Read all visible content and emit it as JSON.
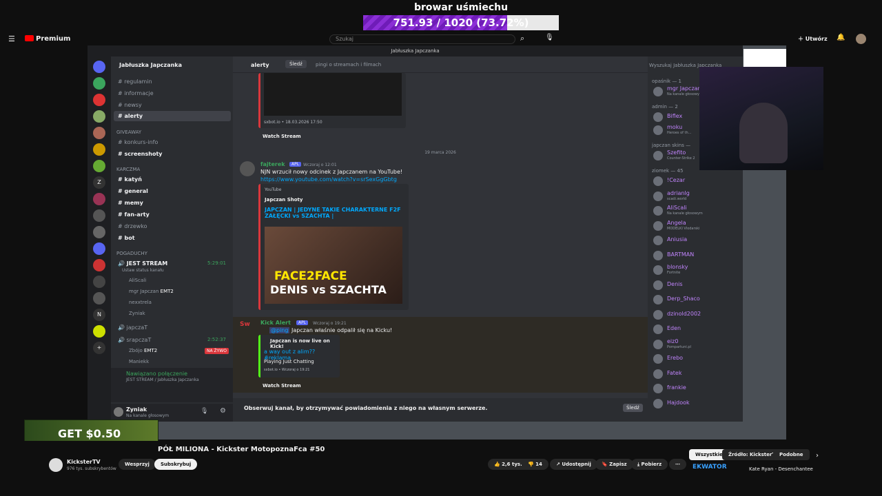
{
  "overlay": {
    "title": "browar uśmiechu",
    "progress_text": "751.93 / 1020 (73.72%)",
    "progress_fraction": 0.7372
  },
  "youtube": {
    "logo": "Premium",
    "search_placeholder": "Szukaj",
    "create_label": "Utwórz",
    "video_title": "PÓŁ MILIONA - Kickster MotopoznaFca #50",
    "channel_name": "KicksterTV",
    "subscribers": "976 tys. subskrybentów",
    "support_label": "Wesprzyj",
    "subscribe_label": "Subskrybuj",
    "likes": "2,6 tys.",
    "dislikes": "14",
    "share_label": "Udostępnij",
    "save_label": "Zapisz",
    "download_label": "Pobierz",
    "filters": [
      "Wszystkie",
      "Źródło: KicksterTV",
      "Podobne"
    ],
    "next_video": "Kate Ryan - Desenchantee",
    "next_banner": "EKWATOR"
  },
  "ad": {
    "text": "GET $0.50"
  },
  "discord": {
    "window_title": "Jabłuszka Japczanka",
    "server_name": "Jabłuszka Japczanka",
    "channels_top": [
      "regulamin",
      "informacje",
      "newsy",
      "alerty"
    ],
    "cat_giveaway": "GIVEAWAY",
    "giveaway_channels": [
      "konkurs-info",
      "screenshoty"
    ],
    "cat_karczma": "KARCZMA",
    "karczma_channels": [
      "katyń",
      "general",
      "memy",
      "fan-arty",
      "drzewko",
      "bot"
    ],
    "cat_pogaduchy": "POGADUCHY",
    "voice_jest_stream": "JEST STREAM",
    "voice_time_1": "5:29:01",
    "voice_status": "Ustaw status kanału",
    "voice_users_1": [
      "AliScali",
      "mgr Japczan",
      "nexxtrela",
      "Zyniak"
    ],
    "voice_users_tag": "EMT2",
    "voice_japcza": "japczaT",
    "voice_srapcza": "srapczaT",
    "voice_time_2": "2:52:37",
    "voice_users_2": [
      "Zbójo",
      "Maniekk"
    ],
    "live_badge": "NA ŻYWO",
    "connection_status": "Nawiązano połączenie",
    "connection_detail": "JEST STREAM / Jabłuszka Japczanka",
    "self_user": "Zyniak",
    "self_status": "Na kanale głosowym",
    "chat_channel": "alerty",
    "follow_label": "Śledź",
    "chat_topic": "pingi o streamach i filmach",
    "search_placeholder": "Wyszukaj Jabłuszka Japczanka",
    "embed1_footer": "sxbot.io • 18.03.2026 17:50",
    "watch_stream": "Watch Stream",
    "date_divider": "19 marca 2026",
    "msg1_author": "fajterek",
    "msg1_tag": "APL",
    "msg1_time": "Wczoraj o 12:01",
    "msg1_text": "NJN wrzucił nowy odcinek z Japczanem na YouTube!",
    "msg1_link": "https://www.youtube.com/watch?v=srSexGgGbtg",
    "yt_embed_provider": "YouTube",
    "yt_embed_author": "Japczan Shoty",
    "yt_embed_title": "JAPCZAN | JEDYNE TAKIE CHARAKTERNE F2F ZAŁĘCKI vs SZACHTA |",
    "thumb_text1": "FACE2FACE",
    "thumb_text2": "DENIS vs SZACHTA",
    "msg2_author": "Kick Alert",
    "msg2_tag": "APL",
    "msg2_time": "Wczoraj o 19:21",
    "msg2_ping": "@ping",
    "msg2_text": "Japczan właśnie odpalił się na Kicku!",
    "kick_embed_title": "Japczan is now live on Kick!",
    "kick_embed_link": "a way out z alim?? #reklama",
    "kick_embed_playing": "Playing Just Chatting",
    "kick_embed_footer": "sxbot.io • Wczoraj o 19:21",
    "follow_bar_text": "Obserwuj kanał, by otrzymywać powiadomienia z niego na własnym serwerze.",
    "members_groups": [
      {
        "label": "opaśnik — 1",
        "members": [
          {
            "name": "mgr Japczan",
            "sub": "Na kanale głosowym"
          }
        ]
      },
      {
        "label": "admin — 2",
        "members": [
          {
            "name": "Biflex",
            "sub": ""
          },
          {
            "name": "moku",
            "sub": "Heroes of th..."
          }
        ]
      },
      {
        "label": "japczan skins —",
        "members": [
          {
            "name": "Szefito",
            "sub": "Counter-Strike 2"
          }
        ]
      },
      {
        "label": "ziomek — 45",
        "members": [
          {
            "name": "!Cezar",
            "sub": ""
          },
          {
            "name": "adrianlg",
            "sub": "scadi.world"
          },
          {
            "name": "AliScali",
            "sub": "Na kanale głosowym"
          },
          {
            "name": "Angela",
            "sub": "MODELKI Vlodarski"
          },
          {
            "name": "Aniusia",
            "sub": ""
          },
          {
            "name": "BARTMAN",
            "sub": ""
          },
          {
            "name": "blonsky",
            "sub": "Fortnite"
          },
          {
            "name": "Denis",
            "sub": ""
          },
          {
            "name": "Derp_Shaco",
            "sub": ""
          },
          {
            "name": "dzinold2002",
            "sub": ""
          },
          {
            "name": "Eden",
            "sub": ""
          },
          {
            "name": "eiz0",
            "sub": "Pompartuni.pl"
          },
          {
            "name": "Erebo",
            "sub": ""
          },
          {
            "name": "Fatek",
            "sub": ""
          },
          {
            "name": "frankie",
            "sub": ""
          },
          {
            "name": "Hajdook",
            "sub": ""
          }
        ]
      }
    ]
  },
  "colors": {
    "accent": "#5865f2",
    "discord_bg": "#313338",
    "member_name": "#c084fc",
    "link": "#00a8fc",
    "progress": "#8b2fd6"
  }
}
